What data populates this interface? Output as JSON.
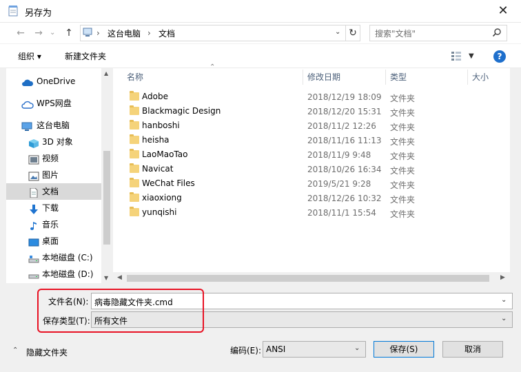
{
  "window": {
    "title": "另存为",
    "close_glyph": "✕"
  },
  "nav": {
    "back_glyph": "←",
    "forward_glyph": "→",
    "up_glyph": "↑",
    "breadcrumb": [
      "这台电脑",
      "文档"
    ],
    "separator": "›",
    "refresh_glyph": "↻",
    "search_placeholder": "搜索\"文档\"",
    "search_icon": "🔍"
  },
  "toolbar": {
    "organize": "组织 ▾",
    "new_folder": "新建文件夹",
    "help": "?"
  },
  "sidebar": [
    {
      "label": "OneDrive",
      "icon": "cloud-icon"
    },
    {
      "label": "WPS网盘",
      "icon": "cloud-outline-icon"
    },
    {
      "label": "这台电脑",
      "icon": "computer-icon"
    },
    {
      "label": "3D 对象",
      "icon": "cube-icon"
    },
    {
      "label": "视频",
      "icon": "video-icon"
    },
    {
      "label": "图片",
      "icon": "picture-icon"
    },
    {
      "label": "文档",
      "icon": "document-icon"
    },
    {
      "label": "下载",
      "icon": "download-icon"
    },
    {
      "label": "音乐",
      "icon": "music-icon"
    },
    {
      "label": "桌面",
      "icon": "desktop-icon"
    },
    {
      "label": "本地磁盘 (C:)",
      "icon": "drive-icon"
    },
    {
      "label": "本地磁盘 (D:)",
      "icon": "drive-icon"
    }
  ],
  "columns": {
    "name": "名称",
    "date": "修改日期",
    "type": "类型",
    "size": "大小"
  },
  "files": [
    {
      "name": "Adobe",
      "date": "2018/12/19 18:09",
      "type": "文件夹"
    },
    {
      "name": "Blackmagic Design",
      "date": "2018/12/20 15:31",
      "type": "文件夹"
    },
    {
      "name": "hanboshi",
      "date": "2018/11/2 12:26",
      "type": "文件夹"
    },
    {
      "name": "heisha",
      "date": "2018/11/16 11:13",
      "type": "文件夹"
    },
    {
      "name": "LaoMaoTao",
      "date": "2018/11/9 9:48",
      "type": "文件夹"
    },
    {
      "name": "Navicat",
      "date": "2018/10/26 16:34",
      "type": "文件夹"
    },
    {
      "name": "WeChat Files",
      "date": "2019/5/21 9:28",
      "type": "文件夹"
    },
    {
      "name": "xiaoxiong",
      "date": "2018/12/26 10:32",
      "type": "文件夹"
    },
    {
      "name": "yunqishi",
      "date": "2018/11/1 15:54",
      "type": "文件夹"
    }
  ],
  "form": {
    "filename_label": "文件名(N):",
    "filename_value": "病毒隐藏文件夹.cmd",
    "filetype_label": "保存类型(T):",
    "filetype_value": "所有文件",
    "hide_folders": "隐藏文件夹",
    "encoding_label": "编码(E):",
    "encoding_value": "ANSI",
    "save": "保存(S)",
    "cancel": "取消"
  },
  "colors": {
    "highlight": "#e81123",
    "accent": "#0078d7",
    "selected": "#d9d9d9"
  }
}
